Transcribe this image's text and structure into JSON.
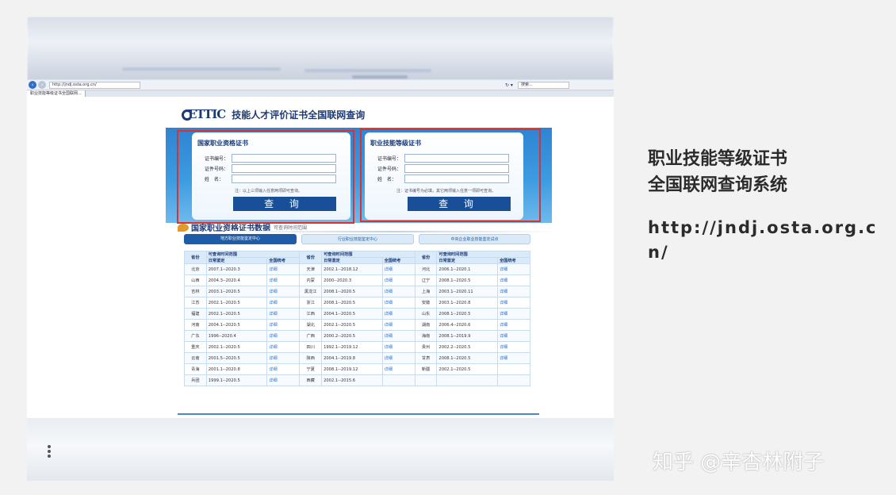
{
  "browser": {
    "address": "http://jndj.osta.org.cn/",
    "search_placeholder": "搜索...",
    "tab_title": "职业技能等级证书全国联网...",
    "refresh_symbol": "↻ ▾"
  },
  "site": {
    "logo": "ETTIC",
    "title": "技能人才评价证书全国联网查询"
  },
  "left_panel": {
    "title": "国家职业资格证书",
    "fields": [
      "证书编号：",
      "证件号码：",
      "姓　名："
    ],
    "note": "注：以上三项输入任意两项即可查询。",
    "button": "查 询"
  },
  "right_panel": {
    "title": "职业技能等级证书",
    "fields": [
      "证书编号：",
      "证件号码：",
      "姓　名："
    ],
    "note": "注：证书编号为必填，其它两项输入任意一项即可查询。",
    "button": "查 询"
  },
  "data_section": {
    "title": "国家职业资格证书数据",
    "subtitle": "可查询时间范围",
    "tabs": [
      "地方职业技能鉴定中心",
      "行业职业技能鉴定中心",
      "中央企业职业技能鉴定试点"
    ]
  },
  "table": {
    "h_prov": "省份",
    "h_range": "可查询时间范围",
    "h_daily": "日常鉴定",
    "h_national": "全国统考",
    "rows": [
      [
        [
          "北京",
          "2007.1--2020.3",
          "详细"
        ],
        [
          "天津",
          "2002.1--2018.12",
          "详细"
        ],
        [
          "河北",
          "2006.1--2020.1",
          "详细"
        ]
      ],
      [
        [
          "山西",
          "2004.3--2020.4",
          "详细"
        ],
        [
          "内蒙",
          "2000--2020.3",
          "详细"
        ],
        [
          "辽宁",
          "2008.1--2020.5",
          "详细"
        ]
      ],
      [
        [
          "吉林",
          "2003.1--2020.5",
          "详细"
        ],
        [
          "黑龙江",
          "2008.1--2020.5",
          "详细"
        ],
        [
          "上海",
          "2003.1--2020.11",
          "详细"
        ]
      ],
      [
        [
          "江苏",
          "2002.1--2020.5",
          "详细"
        ],
        [
          "浙江",
          "2008.1--2020.5",
          "详细"
        ],
        [
          "安徽",
          "2003.1--2020.8",
          "详细"
        ]
      ],
      [
        [
          "福建",
          "2002.1--2020.5",
          "详细"
        ],
        [
          "江西",
          "2004.1--2020.5",
          "详细"
        ],
        [
          "山东",
          "2008.1--2020.5",
          "详细"
        ]
      ],
      [
        [
          "河南",
          "2004.1--2020.5",
          "详细"
        ],
        [
          "湖北",
          "2002.1--2020.5",
          "详细"
        ],
        [
          "湖南",
          "2006.4--2020.6",
          "详细"
        ]
      ],
      [
        [
          "广东",
          "1996--2020.4",
          "详细"
        ],
        [
          "广西",
          "2000.2--2020.5",
          "详细"
        ],
        [
          "海南",
          "2008.1--2019.9",
          "详细"
        ]
      ],
      [
        [
          "重庆",
          "2002.1--2020.5",
          "详细"
        ],
        [
          "四川",
          "1992.1--2019.12",
          "详细"
        ],
        [
          "贵州",
          "2002.2--2020.5",
          "详细"
        ]
      ],
      [
        [
          "云南",
          "2001.5--2020.5",
          "详细"
        ],
        [
          "陕西",
          "2004.1--2019.8",
          "详细"
        ],
        [
          "甘肃",
          "2008.1--2020.5",
          "详细"
        ]
      ],
      [
        [
          "青海",
          "2001.1--2020.8",
          "详细"
        ],
        [
          "宁夏",
          "2008.1--2019.12",
          "详细"
        ],
        [
          "新疆",
          "2002.1--2020.5",
          ""
        ]
      ],
      [
        [
          "兵团",
          "1999.1--2020.5",
          "详细"
        ],
        [
          "西藏",
          "2002.1--2015.6",
          ""
        ],
        [
          "",
          "",
          ""
        ]
      ]
    ]
  },
  "caption": {
    "line1": "职业技能等级证书",
    "line2": "全国联网查询系统",
    "url": "http://jndj.osta.org.cn/"
  },
  "watermark": "知乎 @辛杏林附子",
  "colors": {
    "accent": "#184f98",
    "highlight_frame": "#d9322f",
    "banner": "#3d9be0"
  }
}
